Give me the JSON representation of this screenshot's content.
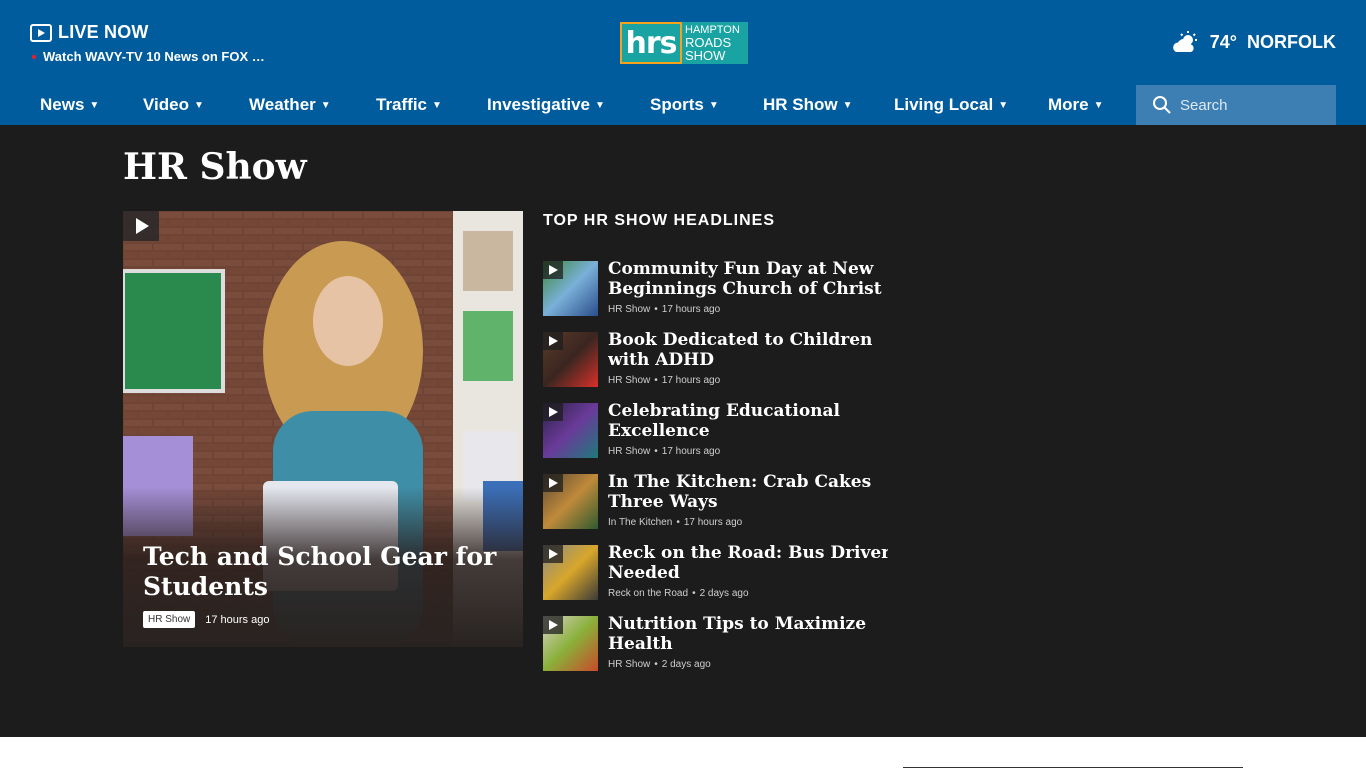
{
  "header": {
    "live_title": "LIVE NOW",
    "live_subtitle": "Watch WAVY-TV 10 News on FOX …",
    "logo_short": "hrs",
    "logo_line1": "HAMPTON",
    "logo_line2": "ROADS",
    "logo_line3": "SHOW",
    "temperature": "74°",
    "city": "NORFOLK",
    "weather_icon": "partly-cloudy-icon"
  },
  "nav": {
    "items": [
      {
        "label": "News"
      },
      {
        "label": "Video"
      },
      {
        "label": "Weather"
      },
      {
        "label": "Traffic"
      },
      {
        "label": "Investigative"
      },
      {
        "label": "Sports"
      },
      {
        "label": "HR Show"
      },
      {
        "label": "Living Local"
      },
      {
        "label": "More"
      }
    ],
    "search_placeholder": "Search"
  },
  "page": {
    "title": "HR Show"
  },
  "hero": {
    "title": "Tech and School Gear for Students",
    "tag": "HR Show",
    "time": "17 hours ago"
  },
  "headlines": {
    "title": "TOP HR SHOW HEADLINES",
    "items": [
      {
        "title_line1": "Community Fun Day at New",
        "title_line2": "Beginnings Church of Christ …",
        "section": "HR Show",
        "time": "17 hours ago"
      },
      {
        "title_line1": "Book Dedicated to Children",
        "title_line2": "with ADHD",
        "section": "HR Show",
        "time": "17 hours ago"
      },
      {
        "title_line1": "Celebrating Educational",
        "title_line2": "Excellence",
        "section": "HR Show",
        "time": "17 hours ago"
      },
      {
        "title_line1": "In The Kitchen: Crab Cakes",
        "title_line2": "Three Ways",
        "section": "In The Kitchen",
        "time": "17 hours ago"
      },
      {
        "title_line1": "Reck on the Road: Bus Drivers",
        "title_line2": "Needed",
        "section": "Reck on the Road",
        "time": "2 days ago"
      },
      {
        "title_line1": "Nutrition Tips to Maximize",
        "title_line2": "Health",
        "section": "HR Show",
        "time": "2 days ago"
      }
    ]
  },
  "colors": {
    "brand_blue": "#015c9d",
    "search_bg": "#3d7fb2",
    "page_bg": "#1c1c1c"
  }
}
